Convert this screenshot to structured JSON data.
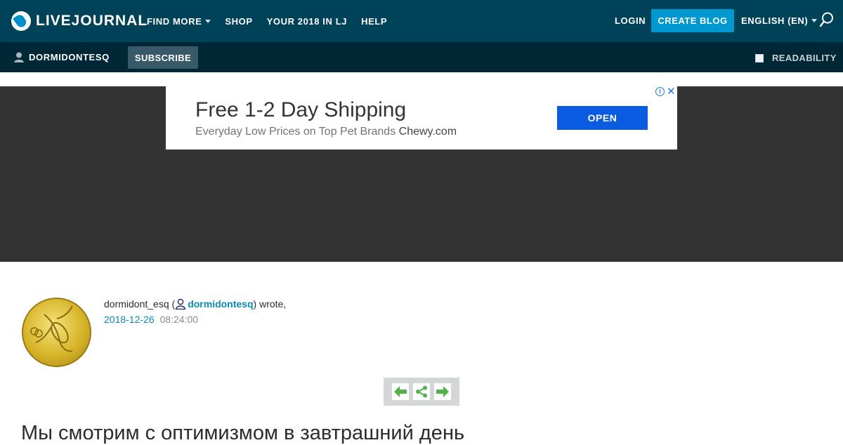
{
  "header": {
    "logo": "LIVEJOURNAL",
    "nav": [
      {
        "label": "FIND MORE",
        "has_menu": true
      },
      {
        "label": "SHOP",
        "has_menu": false
      },
      {
        "label": "YOUR 2018 IN LJ",
        "has_menu": false
      },
      {
        "label": "HELP",
        "has_menu": false
      }
    ],
    "login": "LOGIN",
    "create_blog": "CREATE BLOG",
    "language": "ENGLISH (EN)",
    "search_icon": "search-icon"
  },
  "subheader": {
    "username": "DORMIDONTESQ",
    "subscribe": "SUBSCRIBE",
    "readability": "READABILITY"
  },
  "ad": {
    "title": "Free 1-2 Day Shipping",
    "description": "Everyday Low Prices on Top Pet Brands",
    "brand": "Chewy.com",
    "open": "OPEN",
    "info": "i",
    "close": "✕"
  },
  "post": {
    "author_name": "dormidont_esq",
    "author_link": "dormidontesq",
    "wrote": "wrote,",
    "open_paren": "(",
    "close_paren": ")",
    "date": "2018-12-26",
    "time": "08:24:00",
    "title": "Мы смотрим с оптимизмом в завтрашний день"
  },
  "colors": {
    "header_bg": "#004359",
    "subheader_bg": "#002735",
    "accent": "#0098d0",
    "link": "#0a89b4",
    "toolbar_green": "#55b14c"
  }
}
